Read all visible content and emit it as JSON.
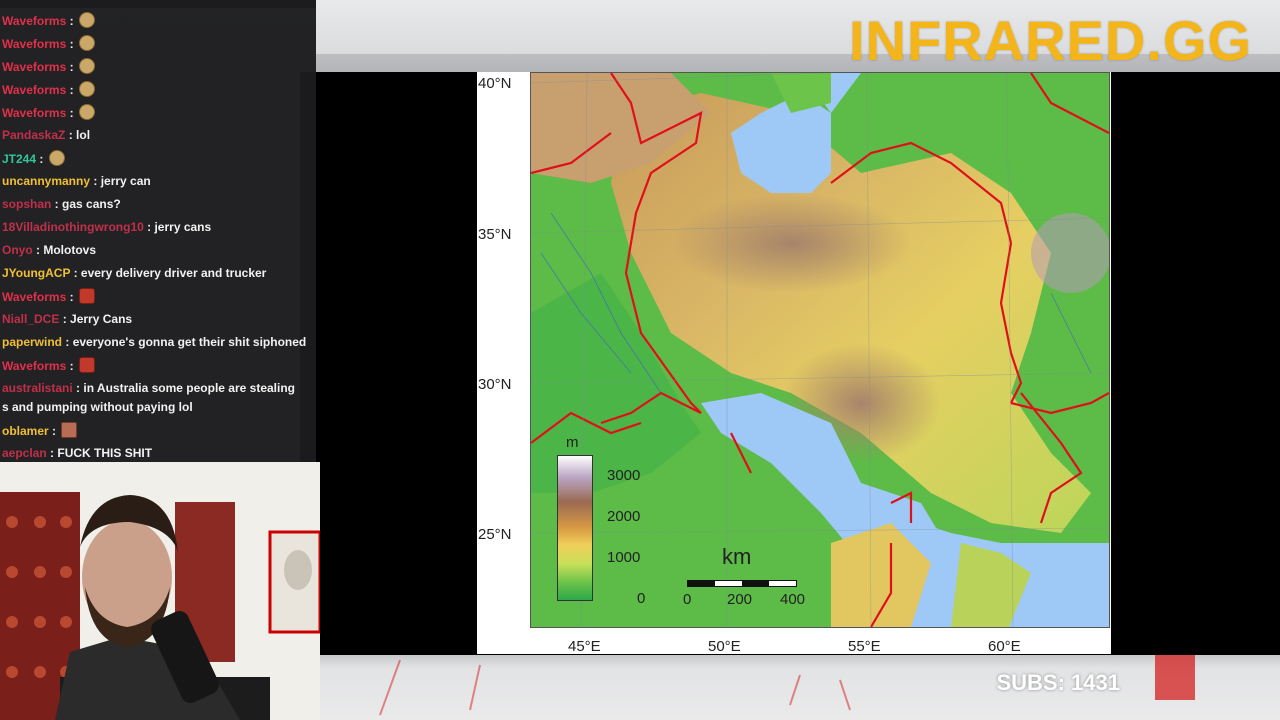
{
  "brand": {
    "text": "INFRARED.GG"
  },
  "subs": {
    "text": "SUBS: 1431"
  },
  "chat": {
    "lines": [
      {
        "user": "Waveforms",
        "user_color": "#e0304a",
        "message": "",
        "emote": "face"
      },
      {
        "user": "Waveforms",
        "user_color": "#e0304a",
        "message": "",
        "emote": "face"
      },
      {
        "user": "Waveforms",
        "user_color": "#e0304a",
        "message": "",
        "emote": "face"
      },
      {
        "user": "Waveforms",
        "user_color": "#e0304a",
        "message": "",
        "emote": "face"
      },
      {
        "user": "Waveforms",
        "user_color": "#e0304a",
        "message": "",
        "emote": "face"
      },
      {
        "user": "PandaskaZ",
        "user_color": "#c0304a",
        "message": "lol"
      },
      {
        "user": "JT244",
        "user_color": "#2fc79a",
        "message": "",
        "emote": "face"
      },
      {
        "user": "uncannymanny",
        "user_color": "#f0c030",
        "message": "jerry can"
      },
      {
        "user": "sopshan",
        "user_color": "#c0304a",
        "message": "gas cans?"
      },
      {
        "user": "18Villadinothingwrong10",
        "user_color": "#c0304a",
        "message": "jerry cans"
      },
      {
        "user": "Onyo",
        "user_color": "#c0304a",
        "message": "Molotovs"
      },
      {
        "user": "JYoungACP",
        "user_color": "#f0c030",
        "message": "every delivery driver and trucker"
      },
      {
        "user": "Waveforms",
        "user_color": "#e0304a",
        "message": "",
        "emote": "red"
      },
      {
        "user": "Niall_DCE",
        "user_color": "#c0304a",
        "message": "Jerry Cans"
      },
      {
        "user": "paperwind",
        "user_color": "#f0c030",
        "message": "everyone's gonna get their shit siphoned"
      },
      {
        "user": "Waveforms",
        "user_color": "#e0304a",
        "message": "",
        "emote": "red"
      },
      {
        "user": "australistani",
        "user_color": "#c0304a",
        "message": "in Australia some people are stealing"
      },
      {
        "user": "",
        "user_color": "#f2f2f2",
        "message": "s and pumping without paying lol"
      },
      {
        "user": "oblamer",
        "user_color": "#f0c030",
        "message": "",
        "emote": "box"
      },
      {
        "user": "aepclan",
        "user_color": "#c0304a",
        "message": "FUCK THIS SHIT"
      }
    ]
  },
  "map": {
    "lat_labels": [
      "40°N",
      "35°N",
      "30°N",
      "25°N"
    ],
    "lon_labels": [
      "45°E",
      "50°E",
      "55°E",
      "60°E"
    ],
    "legend_unit": "m",
    "legend_ticks": [
      "3000",
      "2000",
      "1000",
      "0"
    ],
    "scale_unit": "km",
    "scale_ticks": [
      "0",
      "200",
      "400"
    ]
  },
  "colors": {
    "brand": "#f3b51a",
    "border_red": "#e0101a",
    "water": "#9ec8f5",
    "lowland": "#5cc04a"
  }
}
